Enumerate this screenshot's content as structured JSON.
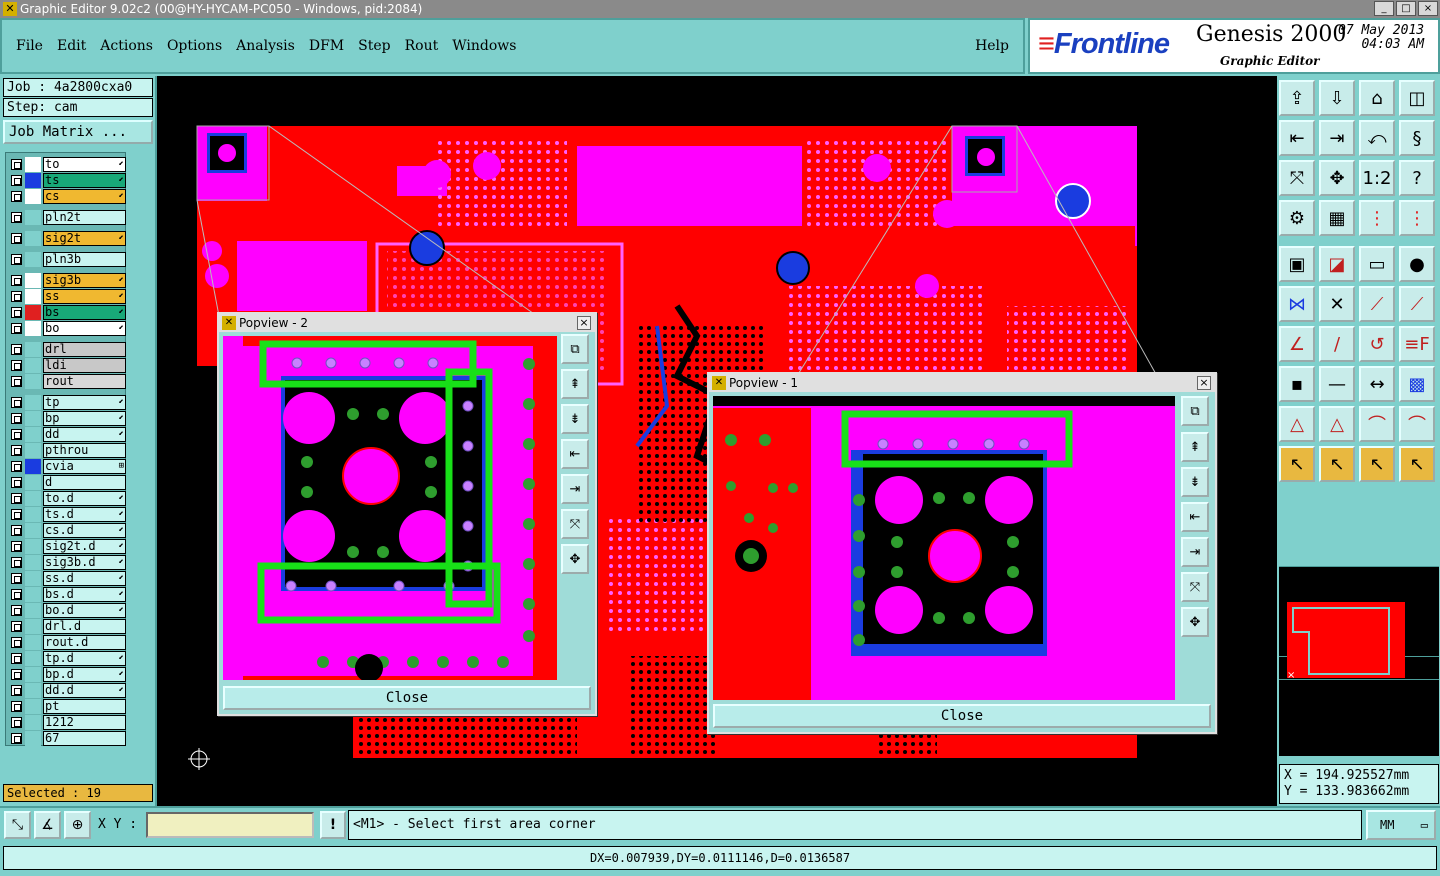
{
  "window": {
    "title": "Graphic Editor 9.02c2 (00@HY-HYCAM-PC050 - Windows, pid:2084)",
    "min": "_",
    "max": "□",
    "close": "×"
  },
  "menu": {
    "items": [
      "File",
      "Edit",
      "Actions",
      "Options",
      "Analysis",
      "DFM",
      "Step",
      "Rout",
      "Windows"
    ],
    "help": "Help"
  },
  "brand": {
    "logo": "Frontline",
    "product": "Genesis 2000",
    "subtitle": "Graphic Editor",
    "date": "07 May 2013",
    "time": "04:03 AM"
  },
  "job": {
    "job_label": "Job : 4a2800cxa0",
    "step_label": "Step: cam",
    "matrix_button": "Job Matrix ..."
  },
  "layers": [
    {
      "name": "to",
      "color": "#ffffff",
      "bg": "#ffffff",
      "tag": "⬋"
    },
    {
      "name": "ts",
      "color": "#1a3ce0",
      "bg": "#18a878",
      "tag": "⬋"
    },
    {
      "name": "cs",
      "color": "#ffffff",
      "bg": "#f0b830",
      "tag": "⬋"
    },
    {
      "name": "pln2t",
      "color": "#7fd0cc",
      "bg": "#c8f4f0",
      "tag": ""
    },
    {
      "name": "sig2t",
      "color": "#7fd0cc",
      "bg": "#f0b830",
      "tag": "⬋"
    },
    {
      "name": "pln3b",
      "color": "#7fd0cc",
      "bg": "#c8f4f0",
      "tag": ""
    },
    {
      "name": "sig3b",
      "color": "#ffffff",
      "bg": "#f0b830",
      "tag": "⬋"
    },
    {
      "name": "ss",
      "color": "#ffffff",
      "bg": "#f0b830",
      "tag": "⬋"
    },
    {
      "name": "bs",
      "color": "#e02020",
      "bg": "#18a878",
      "tag": "⬋"
    },
    {
      "name": "bo",
      "color": "#ffffff",
      "bg": "#ffffff",
      "tag": "⬋"
    },
    {
      "name": "drl",
      "color": "#7fd0cc",
      "bg": "#c8c8c8",
      "tag": ""
    },
    {
      "name": "ldi",
      "color": "#7fd0cc",
      "bg": "#c8c8c8",
      "tag": ""
    },
    {
      "name": "rout",
      "color": "#7fd0cc",
      "bg": "#d8d8d8",
      "tag": ""
    },
    {
      "name": "tp",
      "color": "#7fd0cc",
      "bg": "#c8f4f0",
      "tag": "⬋"
    },
    {
      "name": "bp",
      "color": "#7fd0cc",
      "bg": "#c8f4f0",
      "tag": "⬋"
    },
    {
      "name": "dd",
      "color": "#7fd0cc",
      "bg": "#c8f4f0",
      "tag": "⬋"
    },
    {
      "name": "pthrou",
      "color": "#7fd0cc",
      "bg": "#c8f4f0",
      "tag": ""
    },
    {
      "name": "cvia",
      "color": "#1a3ce0",
      "bg": "#c8f4f0",
      "tag": "⊞"
    },
    {
      "name": "d",
      "color": "#7fd0cc",
      "bg": "#c8f4f0",
      "tag": ""
    },
    {
      "name": "to.d",
      "color": "#7fd0cc",
      "bg": "#c8f4f0",
      "tag": "⬋"
    },
    {
      "name": "ts.d",
      "color": "#7fd0cc",
      "bg": "#c8f4f0",
      "tag": "⬋"
    },
    {
      "name": "cs.d",
      "color": "#7fd0cc",
      "bg": "#c8f4f0",
      "tag": "⬋"
    },
    {
      "name": "sig2t.d",
      "color": "#7fd0cc",
      "bg": "#c8f4f0",
      "tag": "⬋"
    },
    {
      "name": "sig3b.d",
      "color": "#7fd0cc",
      "bg": "#c8f4f0",
      "tag": "⬋"
    },
    {
      "name": "ss.d",
      "color": "#7fd0cc",
      "bg": "#c8f4f0",
      "tag": "⬋"
    },
    {
      "name": "bs.d",
      "color": "#7fd0cc",
      "bg": "#c8f4f0",
      "tag": "⬋"
    },
    {
      "name": "bo.d",
      "color": "#7fd0cc",
      "bg": "#c8f4f0",
      "tag": "⬋"
    },
    {
      "name": "drl.d",
      "color": "#7fd0cc",
      "bg": "#c8f4f0",
      "tag": ""
    },
    {
      "name": "rout.d",
      "color": "#7fd0cc",
      "bg": "#c8f4f0",
      "tag": ""
    },
    {
      "name": "tp.d",
      "color": "#7fd0cc",
      "bg": "#c8f4f0",
      "tag": "⬋"
    },
    {
      "name": "bp.d",
      "color": "#7fd0cc",
      "bg": "#c8f4f0",
      "tag": "⬋"
    },
    {
      "name": "dd.d",
      "color": "#7fd0cc",
      "bg": "#c8f4f0",
      "tag": "⬋"
    },
    {
      "name": "pt",
      "color": "#7fd0cc",
      "bg": "#c8f4f0",
      "tag": ""
    },
    {
      "name": "1212",
      "color": "#7fd0cc",
      "bg": "#c8f4f0",
      "tag": ""
    },
    {
      "name": "67",
      "color": "#7fd0cc",
      "bg": "#c8f4f0",
      "tag": ""
    }
  ],
  "selected_label": "Selected : 19",
  "popview2": {
    "title": "Popview - 2",
    "close_label": "Close"
  },
  "popview1": {
    "title": "Popview - 1",
    "close_label": "Close"
  },
  "coords": {
    "x": "X  =  194.925527mm",
    "y": "Y  =  133.983662mm"
  },
  "bottom": {
    "xy_label": "X Y :",
    "xy_value": "",
    "prompt": "<M1> - Select first area corner",
    "units": "MM",
    "units_arrow": "▭",
    "warn_icon": "!"
  },
  "status": "DX=0.007939,DY=0.0111146,D=0.0136587",
  "colors": {
    "board_red": "#ff0000",
    "pad_magenta": "#ff00ff",
    "via_green": "#2e9e2e",
    "highlight_green": "#18e018",
    "blue": "#1a3ce0"
  },
  "tool_icons": [
    "view-home-icon",
    "view-fit-icon",
    "house-icon",
    "window-split-icon",
    "pan-left-icon",
    "pan-right-icon",
    "flip-icon",
    "snake-icon",
    "zoom-fit-icon",
    "zoom-center-icon",
    "zoom-1to2-icon",
    "help-query-icon",
    "settings-icon",
    "grid-icon",
    "layers-red-icon",
    "layers-red2-icon",
    "select-icon",
    "draw-icon",
    "measure-icon",
    "pad-icon",
    "net-icon",
    "cross-icon",
    "connect-icon",
    "route-icon",
    "angle-icon",
    "line-icon",
    "arc-icon",
    "fontF-icon",
    "move-icon",
    "minus-icon",
    "resize-icon",
    "multi-icon",
    "triangle-icon",
    "poly-icon",
    "arch-icon",
    "arch2-icon",
    "pointer-icon",
    "pointer-box-icon",
    "pointer-sel-icon",
    "pointer-net-icon"
  ]
}
